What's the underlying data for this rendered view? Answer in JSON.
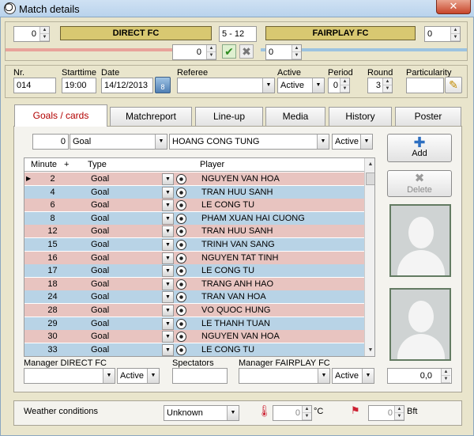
{
  "window": {
    "title": "Match details",
    "close_symbol": "✕"
  },
  "score": {
    "home_spin": "0",
    "home_team": "DIRECT FC",
    "result": "5  - 12",
    "away_team": "FAIRPLAY FC",
    "away_spin": "0",
    "home_sub": "0",
    "away_sub": "0"
  },
  "info": {
    "nr_label": "Nr.",
    "nr": "014",
    "starttime_label": "Starttime",
    "starttime": "19:00",
    "date_label": "Date",
    "date": "14/12/2013",
    "referee_label": "Referee",
    "referee": "",
    "active_label": "Active",
    "active": "Active",
    "period_label": "Period",
    "period": "0",
    "round_label": "Round",
    "round": "3",
    "particularity_label": "Particularity",
    "particularity": ""
  },
  "tabs": [
    "Goals / cards",
    "Matchreport",
    "Line-up",
    "Media",
    "History",
    "Poster"
  ],
  "filter": {
    "number": "0",
    "type": "Goal",
    "player": "HOANG CONG TUNG",
    "status": "Active"
  },
  "grid": {
    "headers": {
      "minute": "Minute",
      "plus": "+",
      "type": "Type",
      "player": "Player"
    },
    "rows": [
      {
        "minute": "2",
        "type": "Goal",
        "player": "NGUYEN VAN HOA"
      },
      {
        "minute": "4",
        "type": "Goal",
        "player": "TRAN HUU SANH"
      },
      {
        "minute": "6",
        "type": "Goal",
        "player": "LE CONG TU"
      },
      {
        "minute": "8",
        "type": "Goal",
        "player": "PHAM XUAN HAI CUONG"
      },
      {
        "minute": "12",
        "type": "Goal",
        "player": "TRAN HUU SANH"
      },
      {
        "minute": "15",
        "type": "Goal",
        "player": "TRINH VAN SANG"
      },
      {
        "minute": "16",
        "type": "Goal",
        "player": "NGUYEN TAT TINH"
      },
      {
        "minute": "17",
        "type": "Goal",
        "player": "LE CONG TU"
      },
      {
        "minute": "18",
        "type": "Goal",
        "player": "TRANG ANH HAO"
      },
      {
        "minute": "24",
        "type": "Goal",
        "player": "TRAN VAN HOA"
      },
      {
        "minute": "28",
        "type": "Goal",
        "player": "VO QUOC HUNG"
      },
      {
        "minute": "29",
        "type": "Goal",
        "player": "LE THANH TUAN"
      },
      {
        "minute": "30",
        "type": "Goal",
        "player": "NGUYEN VAN HOA"
      },
      {
        "minute": "33",
        "type": "Goal",
        "player": "LE CONG TU"
      }
    ]
  },
  "buttons": {
    "add": "Add",
    "delete": "Delete"
  },
  "bottom": {
    "manager_home_label": "Manager DIRECT FC",
    "manager_home": "",
    "manager_home_status": "Active",
    "spectators_label": "Spectators",
    "spectators": "",
    "manager_away_label": "Manager FAIRPLAY FC",
    "manager_away": "",
    "manager_away_status": "Active",
    "rating": "0,0"
  },
  "weather": {
    "label": "Weather conditions",
    "condition": "Unknown",
    "temp": "0",
    "temp_unit": "°C",
    "wind": "0",
    "wind_unit": "Bft"
  },
  "colors": {
    "home_stripe": "#e8a39b",
    "away_stripe": "#9cc3e0",
    "accent_tab": "#b20000"
  }
}
